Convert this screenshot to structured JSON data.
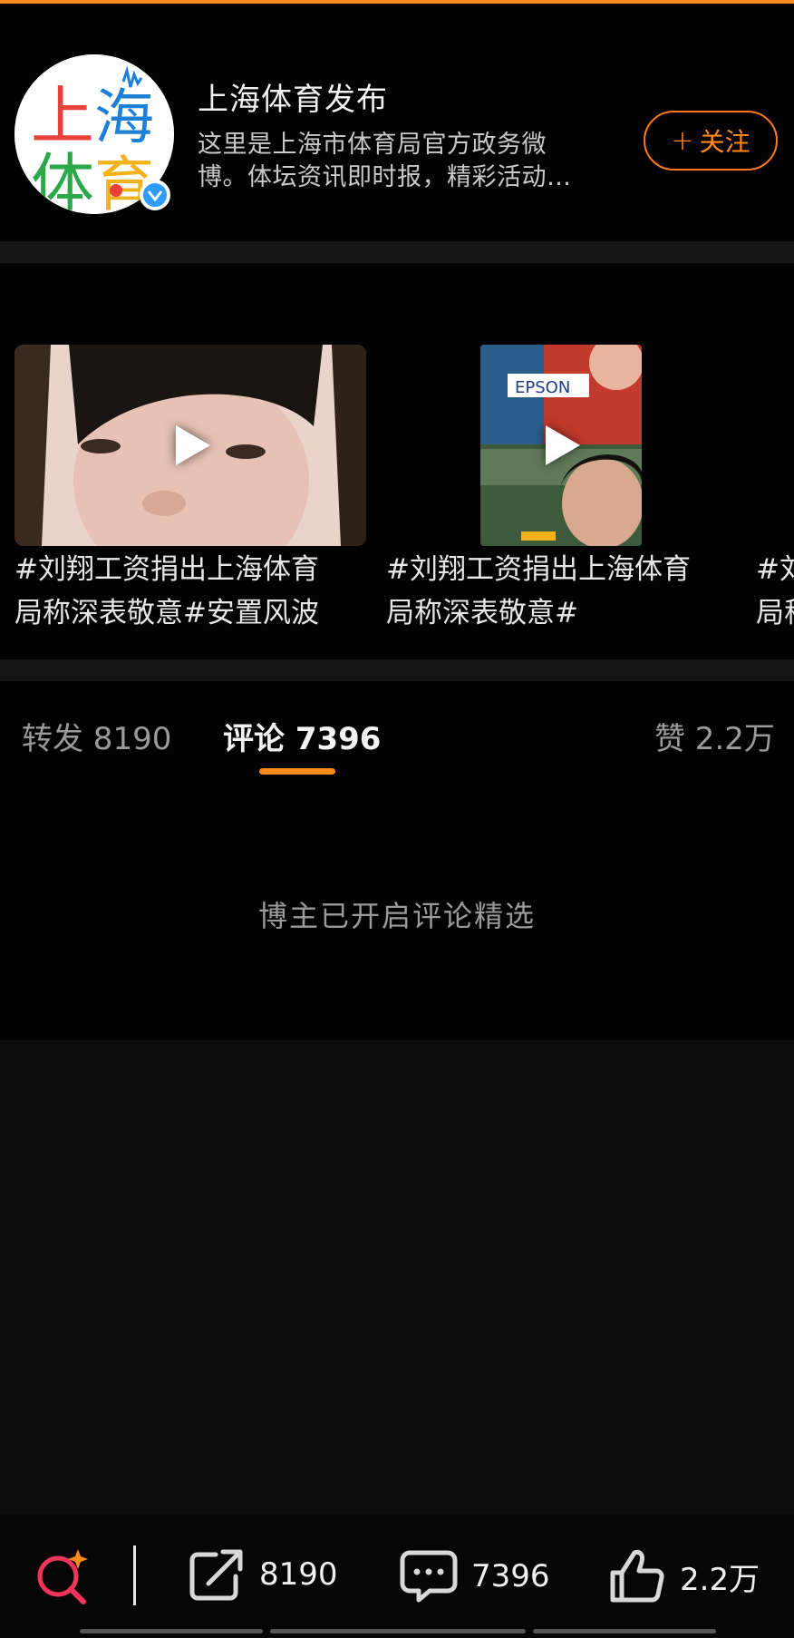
{
  "profile": {
    "name": "上海体育发布",
    "bio_line1": "这里是上海市体育局官方政务微",
    "bio_line2": "博。体坛资讯即时报，精彩活动…",
    "follow_label": "关注",
    "follow_plus": "+",
    "verified": true,
    "avatar_text": [
      "上",
      "海",
      "体",
      "育"
    ]
  },
  "videos": [
    {
      "title_line1": "#刘翔工资捐出上海体育",
      "title_line2": "局称深表敬意#安置风波"
    },
    {
      "title_line1": "#刘翔工资捐出上海体育",
      "title_line2": "局称深表敬意#",
      "thumb_text": "EPSON"
    },
    {
      "title_line1": "#刘",
      "title_line2": "局称"
    }
  ],
  "tabs": {
    "repost": "转发 8190",
    "comments": "评论 7396",
    "likes": "赞 2.2万"
  },
  "comments": {
    "message": "博主已开启评论精选"
  },
  "actionbar": {
    "repost_count": "8190",
    "comment_count": "7396",
    "like_count": "2.2万"
  },
  "colors": {
    "accent": "#ff8a1c",
    "background": "#020202",
    "verified_blue": "#2e9bff"
  }
}
